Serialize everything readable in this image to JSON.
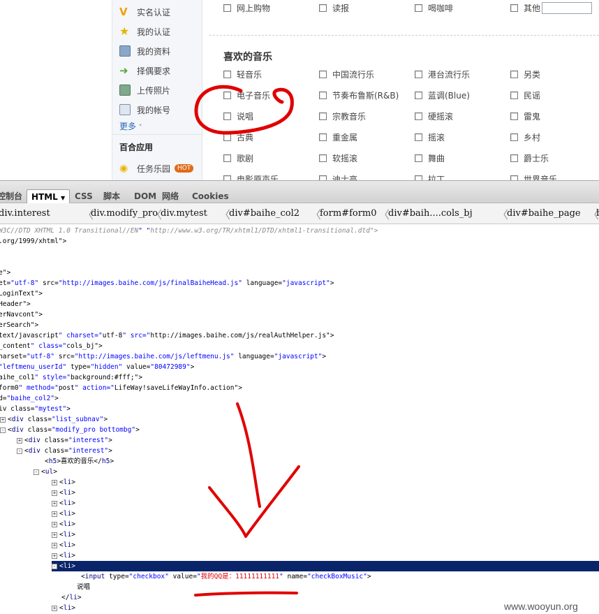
{
  "left_menu": {
    "items": [
      {
        "label": "实名认证",
        "icon": "v-verified-icon",
        "color": "#f0a000"
      },
      {
        "label": "我的认证",
        "icon": "star-badge-icon",
        "color": "#e8b400"
      },
      {
        "label": "我的资料",
        "icon": "profile-card-icon",
        "color": "#6c8fb8"
      },
      {
        "label": "择偶要求",
        "icon": "arrow-right-icon",
        "color": "#5aa33a"
      },
      {
        "label": "上传照片",
        "icon": "photo-icon",
        "color": "#5d8a6a"
      },
      {
        "label": "我的帐号",
        "icon": "account-card-icon",
        "color": "#7a90b0"
      }
    ],
    "more_label": "更多",
    "apps_heading": "百合应用",
    "app_item": {
      "label": "任务乐园",
      "badge": "HOT"
    }
  },
  "top_options": [
    "网上购物",
    "读报",
    "喝咖啡",
    "其他"
  ],
  "music_section": {
    "title": "喜欢的音乐",
    "options": [
      [
        "轻音乐",
        "中国流行乐",
        "港台流行乐",
        "另类"
      ],
      [
        "电子音乐",
        "节奏布鲁斯(R&B)",
        "蓝调(Blue)",
        "民谣"
      ],
      [
        "说唱",
        "宗教音乐",
        "硬摇滚",
        "雷鬼"
      ],
      [
        "古典",
        "重金属",
        "摇滚",
        "乡村"
      ],
      [
        "歌剧",
        "软摇滚",
        "舞曲",
        "爵士乐"
      ],
      [
        "电影原声乐",
        "迪士高",
        "拉丁",
        "世界音乐"
      ]
    ]
  },
  "firebug": {
    "tabs": [
      "控制台",
      "HTML",
      "CSS",
      "脚本",
      "DOM",
      "网络",
      "Cookies"
    ],
    "active_tab": "HTML",
    "breadcrumbs": [
      "div.interest",
      "div.modify_pro",
      "div.mytest",
      "div#baihe_col2",
      "form#form0",
      "div#baih....cols_bj",
      "div#baihe_page",
      "b"
    ],
    "code_lines": [
      {
        "text": "W3C//DTD XHTML 1.0 Transitional//EN\" \"http://www.w3.org/TR/xhtml1/DTD/xhtml1-transitional.dtd\">"
      },
      {
        "text": ".org/1999/xhtml\">"
      },
      {
        "text": ""
      },
      {
        "text": ""
      },
      {
        "text": "e\">"
      },
      {
        "text": "et=\"utf-8\" src=\"http://images.baihe.com/js/finalBaiheHead.js\" language=\"javascript\">"
      },
      {
        "text": "LoginText\">"
      },
      {
        "text": "Header\">"
      },
      {
        "text": "erNavcont\">"
      },
      {
        "text": "erSearch\">"
      },
      {
        "text": "text/javascript\" charset=\"utf-8\" src=\"http://images.baihe.com/js/realAuthHelper.js\">"
      },
      {
        "text": "_content\" class=\"cols_bj\">"
      },
      {
        "text": "harset=\"utf-8\" src=\"http://images.baihe.com/js/leftmenu.js\" language=\"javascript\">"
      },
      {
        "text": "\"leftmenu_userId\" type=\"hidden\" value=\"80472989\">"
      },
      {
        "text": "aihe_col1\" style=\"background:#fff;\">"
      },
      {
        "text": "form0\" method=\"post\" action=\"LifeWay!saveLifeWayInfo.action\">"
      },
      {
        "text": "d=\"baihe_col2\">"
      },
      {
        "text": "iv class=\"mytest\">"
      },
      {
        "text": "<div class=\"list_subnav\">"
      },
      {
        "text": "<div class=\"modify_pro bottombg\">"
      },
      {
        "text": "<div class=\"interest\">"
      },
      {
        "text": "<div class=\"interest\">"
      },
      {
        "text": "<h5>喜欢的音乐</h5>"
      },
      {
        "text": "<ul>"
      },
      {
        "text": "<li>"
      },
      {
        "text": "<li>"
      },
      {
        "text": "<li>"
      },
      {
        "text": "<li>"
      },
      {
        "text": "<li>"
      },
      {
        "text": "<li>"
      },
      {
        "text": "<li>"
      },
      {
        "text": "<li>"
      },
      {
        "text": "<li>"
      },
      {
        "text": "<input type=\"checkbox\" value=\"我的QQ是：11111111111\" name=\"checkBoxMusic\">"
      },
      {
        "text": "说唱"
      },
      {
        "text": "</li>"
      },
      {
        "text": "<li>"
      }
    ]
  },
  "watermark": "www.wooyun.org",
  "annotation_color": "#e00000"
}
